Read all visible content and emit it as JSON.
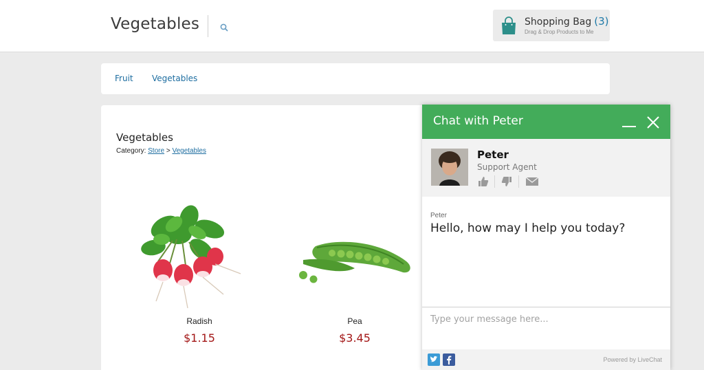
{
  "header": {
    "store_title": "Vegetables",
    "bag": {
      "title": "Shopping Bag",
      "count": "(3)",
      "subtitle": "Drag & Drop Products to Me"
    }
  },
  "category_nav": {
    "items": [
      {
        "label": "Fruit"
      },
      {
        "label": "Vegetables"
      }
    ]
  },
  "content": {
    "heading": "Vegetables",
    "breadcrumb": {
      "prefix": "Category:",
      "store": "Store",
      "separator": ">",
      "current": "Vegetables"
    },
    "products": [
      {
        "name": "Radish",
        "price": "$1.15"
      },
      {
        "name": "Pea",
        "price": "$3.45"
      }
    ]
  },
  "chat": {
    "title": "Chat with Peter",
    "agent": {
      "name": "Peter",
      "role": "Support Agent"
    },
    "message": {
      "author": "Peter",
      "text": "Hello, how may I help you today?"
    },
    "input_placeholder": "Type your message here...",
    "powered_by": "Powered by LiveChat"
  },
  "colors": {
    "chat_header": "#43ac5a",
    "link": "#1d6da0",
    "price": "#a31616",
    "bag_icon": "#2d8f8a"
  },
  "icons": [
    "search-icon",
    "shopping-bag-icon",
    "minimize-icon",
    "close-icon",
    "thumbs-up-icon",
    "thumbs-down-icon",
    "email-icon",
    "twitter-icon",
    "facebook-icon"
  ]
}
